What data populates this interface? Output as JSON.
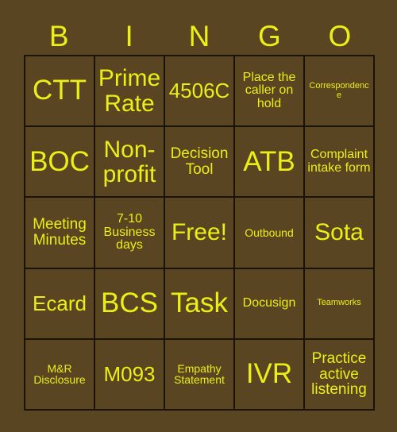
{
  "card": {
    "header_letters": [
      "B",
      "I",
      "N",
      "G",
      "O"
    ],
    "colors": {
      "background": "#5a4522",
      "text": "#e8f015",
      "border": "#1a1408"
    },
    "rows": [
      [
        {
          "text": "CTT",
          "size": "fs-xxl"
        },
        {
          "text": "Prime Rate",
          "size": "fs-xl"
        },
        {
          "text": "4506C",
          "size": "fs-l"
        },
        {
          "text": "Place the caller on hold",
          "size": "fs-s"
        },
        {
          "text": "Correspondence",
          "size": "fs-xxs"
        }
      ],
      [
        {
          "text": "BOC",
          "size": "fs-xxl"
        },
        {
          "text": "Non-profit",
          "size": "fs-xl"
        },
        {
          "text": "Decision Tool",
          "size": "fs-m"
        },
        {
          "text": "ATB",
          "size": "fs-xxl"
        },
        {
          "text": "Complaint intake form",
          "size": "fs-s"
        }
      ],
      [
        {
          "text": "Meeting Minutes",
          "size": "fs-m"
        },
        {
          "text": "7-10 Business days",
          "size": "fs-s"
        },
        {
          "text": "Free!",
          "size": "fs-xl"
        },
        {
          "text": "Outbound",
          "size": "fs-xs"
        },
        {
          "text": "Sota",
          "size": "fs-xl"
        }
      ],
      [
        {
          "text": "Ecard",
          "size": "fs-l"
        },
        {
          "text": "BCS",
          "size": "fs-xxl"
        },
        {
          "text": "Task",
          "size": "fs-xxl"
        },
        {
          "text": "Docusign",
          "size": "fs-s"
        },
        {
          "text": "Teamworks",
          "size": "fs-xxs"
        }
      ],
      [
        {
          "text": "M&R Disclosure",
          "size": "fs-xs"
        },
        {
          "text": "M093",
          "size": "fs-l"
        },
        {
          "text": "Empathy Statement",
          "size": "fs-xs"
        },
        {
          "text": "IVR",
          "size": "fs-xxl"
        },
        {
          "text": "Practice active listening",
          "size": "fs-m"
        }
      ]
    ]
  }
}
